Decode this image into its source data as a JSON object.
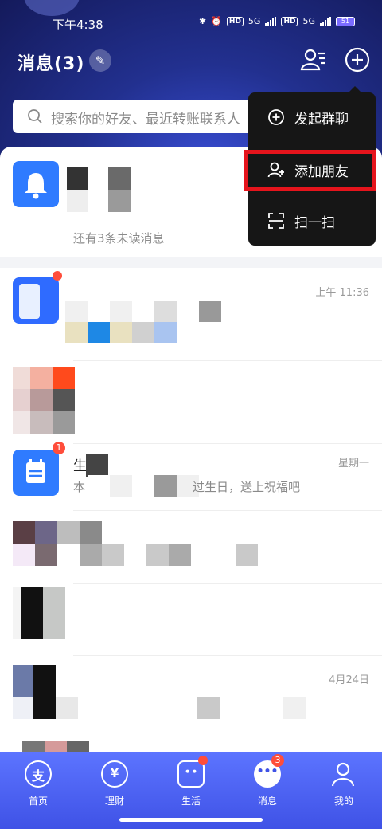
{
  "status_bar": {
    "time": "下午4:38",
    "hd1": "HD",
    "net1": "5G",
    "hd2": "HD",
    "net2": "5G",
    "battery": "51"
  },
  "header": {
    "title": "消息(3)"
  },
  "search": {
    "placeholder": "搜索你的好友、最近转账联系人"
  },
  "popup_menu": {
    "items": [
      {
        "label": "发起群聊",
        "icon": "plus-circle-icon"
      },
      {
        "label": "添加朋友",
        "icon": "add-user-icon",
        "highlighted": true
      },
      {
        "label": "扫一扫",
        "icon": "scan-icon"
      }
    ]
  },
  "messages": {
    "notify": {
      "name": "",
      "sub": "还有3条未读消息"
    },
    "row1": {
      "time": "上午 11:36"
    },
    "row3": {
      "name": "生日",
      "preview_prefix": "本",
      "preview_suffix": "过生日，送上祝福吧",
      "time": "星期一",
      "badge": "1"
    },
    "row6": {
      "time": "4月24日"
    }
  },
  "tabbar": {
    "items": [
      {
        "label": "首页",
        "icon": "alipay-icon"
      },
      {
        "label": "理财",
        "icon": "finance-icon"
      },
      {
        "label": "生活",
        "icon": "life-icon",
        "dot": true
      },
      {
        "label": "消息",
        "icon": "message-icon",
        "badge": "3",
        "active": true
      },
      {
        "label": "我的",
        "icon": "profile-icon"
      }
    ]
  },
  "colors": {
    "accent": "#2f6bff",
    "popup_bg": "#161616",
    "highlight": "#e5141c",
    "badge": "#ff4d3b"
  }
}
